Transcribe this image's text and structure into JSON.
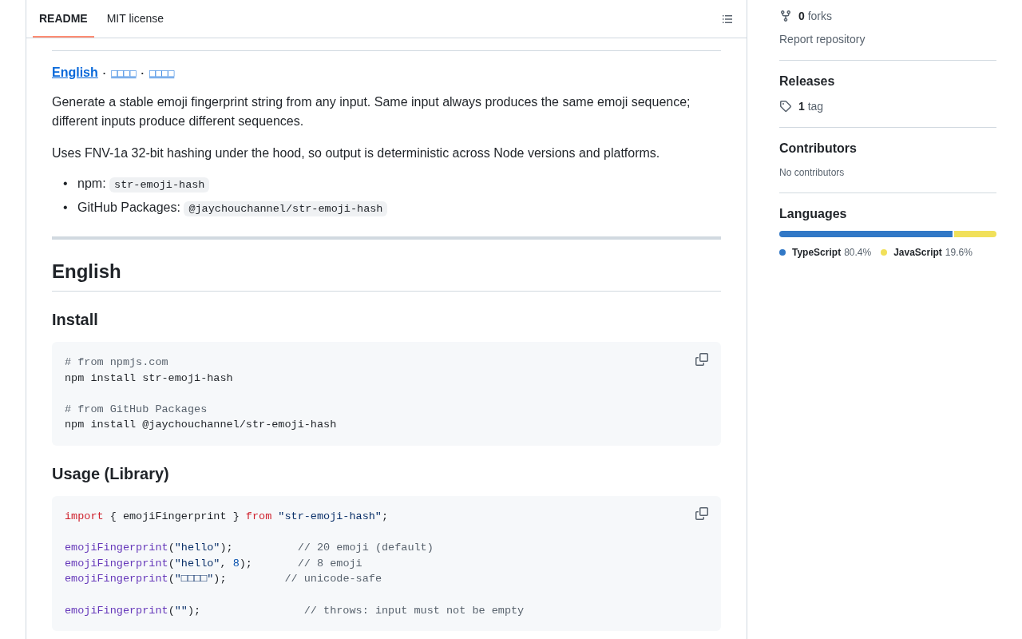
{
  "tabs": [
    {
      "label": "README",
      "selected": true
    },
    {
      "label": "MIT license",
      "selected": false
    }
  ],
  "readme": {
    "link_separator": "·",
    "language_links": [
      {
        "label": "English",
        "selected": true
      },
      {
        "label": "□□□□",
        "selected": false
      },
      {
        "label": "□□□□",
        "selected": false
      }
    ],
    "paragraphs": [
      "Generate a stable emoji fingerprint string from any input. Same input always produces the same emoji sequence; different inputs produce different sequences.",
      "Uses FNV-1a 32-bit hashing under the hood, so output is deterministic across Node versions and platforms."
    ],
    "list": [
      {
        "marker": "•",
        "label": "npm:",
        "code": "str-emoji-hash"
      },
      {
        "marker": "•",
        "label": "GitHub Packages:",
        "code": "@jaychouchannel/str-emoji-hash"
      }
    ],
    "heading": "English",
    "sections": [
      {
        "title": "Install",
        "code_blocks": [
          [
            {
              "tokens": [
                {
                  "kind": "comment",
                  "text": "# from npmjs.com"
                }
              ]
            },
            {
              "tokens": [
                {
                  "kind": "plain",
                  "text": "npm install str-emoji-hash"
                }
              ]
            }
          ],
          [
            {
              "tokens": [
                {
                  "kind": "comment",
                  "text": "# from GitHub Packages"
                }
              ]
            },
            {
              "tokens": [
                {
                  "kind": "plain",
                  "text": "npm install @jaychouchannel/str-emoji-hash"
                }
              ]
            }
          ]
        ]
      },
      {
        "title": "Usage (Library)",
        "code_blocks": [
          [
            {
              "tokens": [
                {
                  "kind": "keyword",
                  "text": "import"
                },
                {
                  "kind": "plain",
                  "text": " { emojiFingerprint } "
                },
                {
                  "kind": "keyword",
                  "text": "from"
                },
                {
                  "kind": "string",
                  "text": " \"str-emoji-hash\""
                },
                {
                  "kind": "plain",
                  "text": ";"
                }
              ]
            }
          ],
          [
            {
              "tokens": [
                {
                  "kind": "func",
                  "text": "emojiFingerprint"
                },
                {
                  "kind": "plain",
                  "text": "("
                },
                {
                  "kind": "string",
                  "text": "\"hello\""
                },
                {
                  "kind": "plain",
                  "text": ");          "
                },
                {
                  "kind": "comment",
                  "text": "// 20 emoji (default)"
                }
              ]
            },
            {
              "tokens": [
                {
                  "kind": "func",
                  "text": "emojiFingerprint"
                },
                {
                  "kind": "plain",
                  "text": "("
                },
                {
                  "kind": "string",
                  "text": "\"hello\""
                },
                {
                  "kind": "plain",
                  "text": ", "
                },
                {
                  "kind": "number",
                  "text": "8"
                },
                {
                  "kind": "plain",
                  "text": ");       "
                },
                {
                  "kind": "comment",
                  "text": "// 8 emoji"
                }
              ]
            },
            {
              "tokens": [
                {
                  "kind": "func",
                  "text": "emojiFingerprint"
                },
                {
                  "kind": "plain",
                  "text": "("
                },
                {
                  "kind": "string",
                  "text": "\"□□□□\""
                },
                {
                  "kind": "plain",
                  "text": ");         "
                },
                {
                  "kind": "comment",
                  "text": "// unicode-safe"
                }
              ]
            }
          ],
          [
            {
              "tokens": [
                {
                  "kind": "func",
                  "text": "emojiFingerprint"
                },
                {
                  "kind": "plain",
                  "text": "("
                },
                {
                  "kind": "string",
                  "text": "\"\""
                },
                {
                  "kind": "plain",
                  "text": ");                "
                },
                {
                  "kind": "comment",
                  "text": "// throws: input must not be empty"
                }
              ]
            }
          ]
        ]
      }
    ]
  },
  "sidebar": {
    "forks_count": "0",
    "forks_label": "forks",
    "report": "Report repository",
    "releases": {
      "title": "Releases",
      "count": "1",
      "label": "tag"
    },
    "contributors": {
      "title": "Contributors",
      "empty": "No contributors"
    },
    "languages": {
      "title": "Languages",
      "items": [
        {
          "name": "TypeScript",
          "percent": "80.4%",
          "level": 0.804,
          "color": "#3178c6"
        },
        {
          "name": "JavaScript",
          "percent": "19.6%",
          "level": 0.196,
          "color": "#f1e05a"
        }
      ]
    }
  }
}
